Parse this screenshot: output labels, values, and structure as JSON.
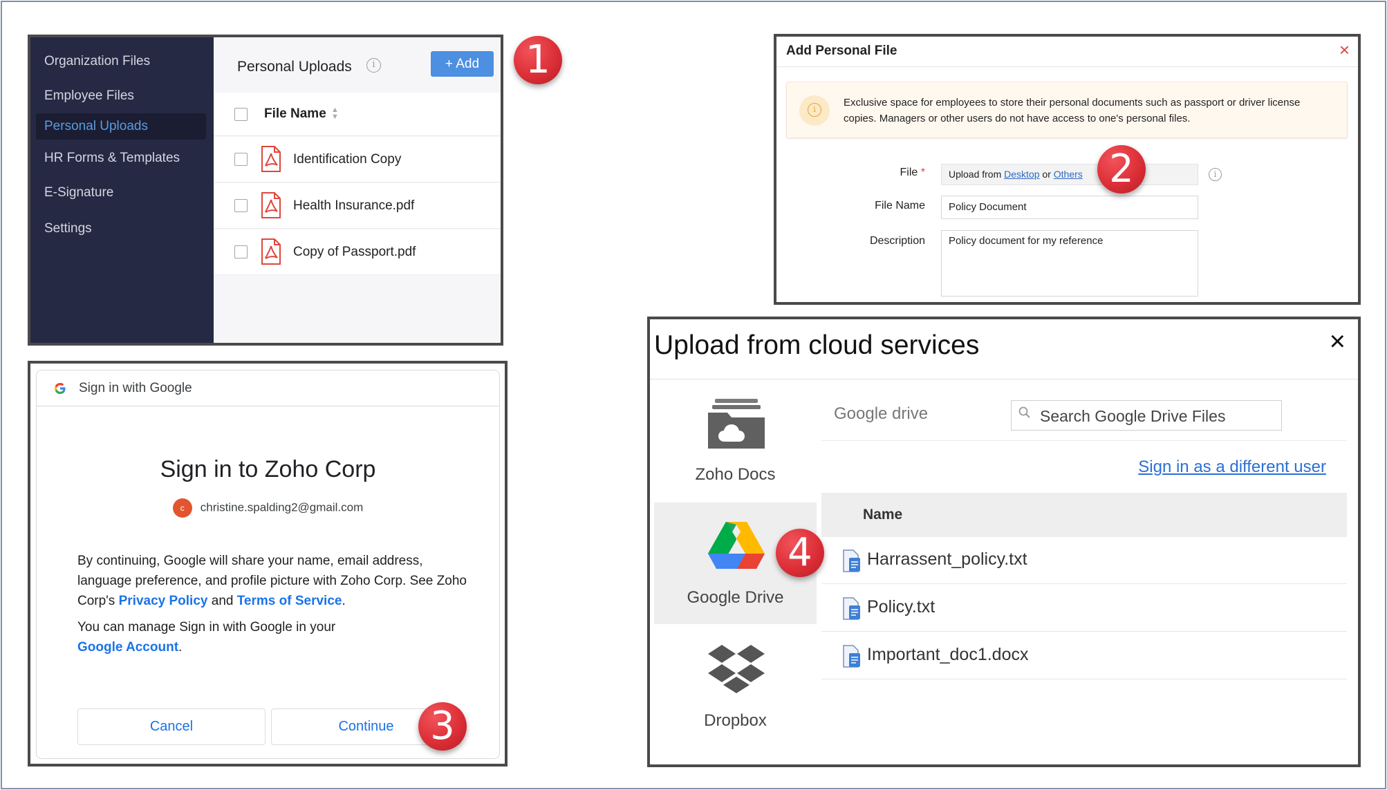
{
  "badges": [
    "1",
    "2",
    "3",
    "4"
  ],
  "personal_uploads": {
    "sidebar": [
      {
        "label": "Organization Files",
        "active": false
      },
      {
        "label": "Employee Files",
        "active": false
      },
      {
        "label": "Personal Uploads",
        "active": true
      },
      {
        "label": "HR Forms & Templates",
        "active": false
      },
      {
        "label": "E-Signature",
        "active": false
      },
      {
        "label": "Settings",
        "active": false
      }
    ],
    "title": "Personal Uploads",
    "info_icon": "info-icon",
    "add_button": "+ Add",
    "column_header": "File Name",
    "files": [
      "Identification Copy",
      "Health Insurance.pdf",
      "Copy of Passport.pdf"
    ]
  },
  "add_personal_file": {
    "title": "Add Personal File",
    "close": "×",
    "notice": "Exclusive space for employees to store their personal documents such as passport or driver license copies. Managers or other users do not have access to one's personal files.",
    "file_label": "File",
    "required_mark": "*",
    "upload_prefix": "Upload from",
    "desktop_link": "Desktop",
    "or_text": "or",
    "others_link": "Others",
    "filename_label": "File Name",
    "filename_value": "Policy Document",
    "description_label": "Description",
    "description_value": "Policy document for my reference"
  },
  "google_signin": {
    "header": "Sign in with Google",
    "title": "Sign in to Zoho Corp",
    "avatar_letter": "c",
    "email": "christine.spalding2@gmail.com",
    "para1_a": "By continuing, Google will share your name, email address, language preference, and profile picture with Zoho Corp. See Zoho Corp's",
    "privacy_link": "Privacy Policy",
    "and_text": "and",
    "terms_link": "Terms of Service",
    "para2_a": "You can manage Sign in with Google in your",
    "account_link": "Google Account",
    "cancel": "Cancel",
    "continue": "Continue"
  },
  "cloud_upload": {
    "title": "Upload from cloud services",
    "close": "×",
    "services": [
      "Zoho Docs",
      "Google Drive",
      "Dropbox"
    ],
    "active_service": "Google Drive",
    "source_label": "Google drive",
    "search_placeholder": "Search Google Drive Files",
    "sign_in_different": "Sign in as a different user",
    "column_header": "Name",
    "files": [
      "Harrassent_policy.txt",
      "Policy.txt",
      "Important_doc1.docx"
    ]
  },
  "colors": {
    "sidebar_bg": "#262943",
    "accent_blue": "#4d8fe0",
    "badge_red": "#dc2f37",
    "google_blue": "#1a73e8"
  }
}
